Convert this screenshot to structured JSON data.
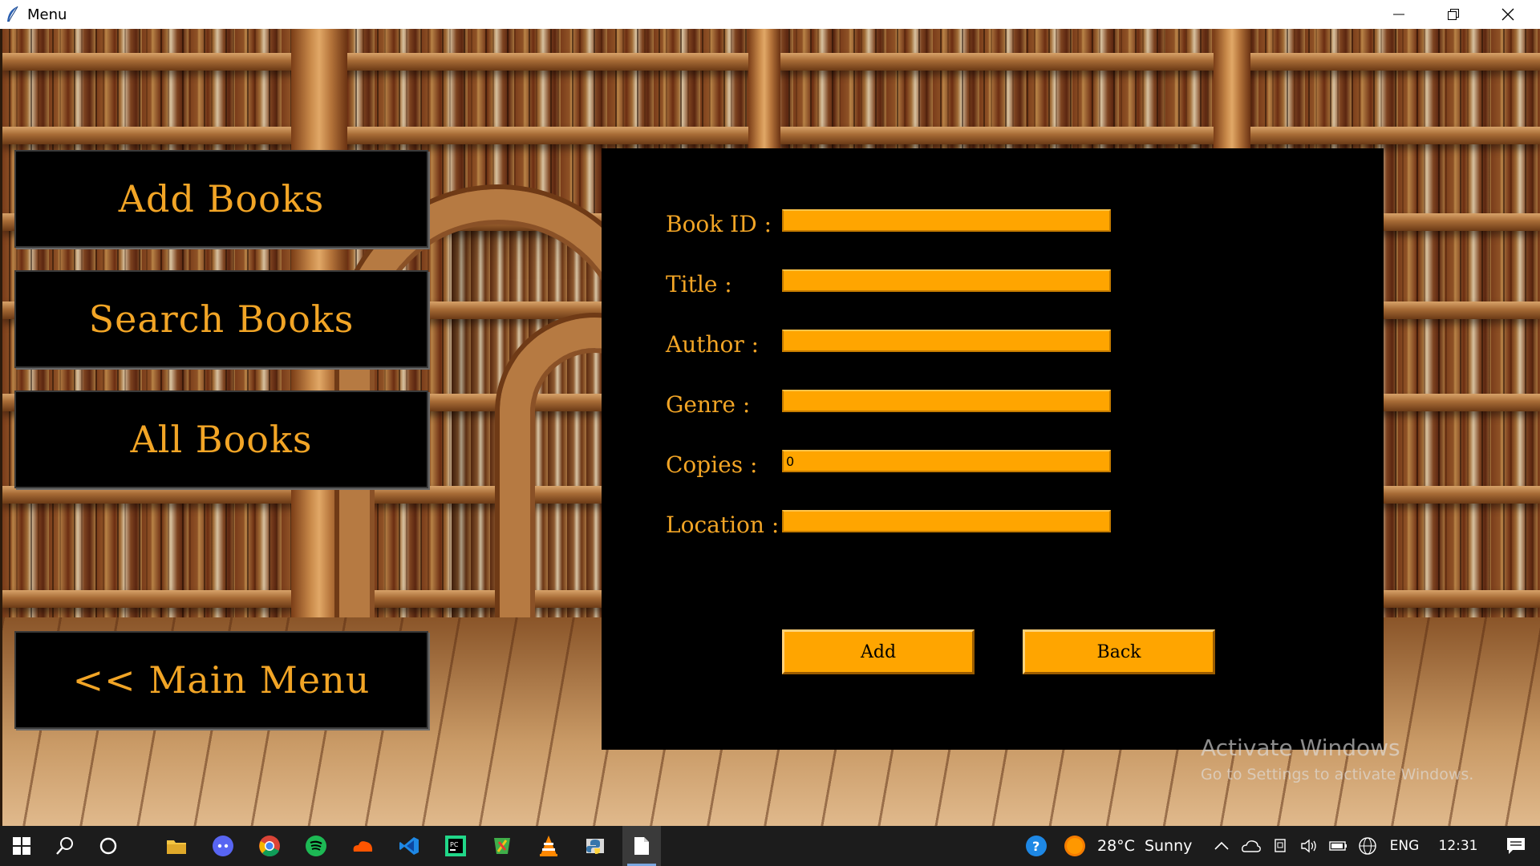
{
  "window": {
    "title": "Menu",
    "controls": [
      "minimize",
      "maximize",
      "close"
    ]
  },
  "menu": {
    "add_books": "Add Books",
    "search_books": "Search Books",
    "all_books": "All Books",
    "main_menu": "<< Main Menu"
  },
  "form": {
    "fields": [
      {
        "label": "Book ID :",
        "value": ""
      },
      {
        "label": "Title :",
        "value": ""
      },
      {
        "label": "Author :",
        "value": ""
      },
      {
        "label": "Genre :",
        "value": ""
      },
      {
        "label": "Copies :",
        "value": "0"
      },
      {
        "label": "Location :",
        "value": ""
      }
    ],
    "add_label": "Add",
    "back_label": "Back"
  },
  "colors": {
    "accent": "#ffa500",
    "label_text": "#f2a526",
    "panel_bg": "#000000"
  },
  "watermark": {
    "line1": "Activate Windows",
    "line2": "Go to Settings to activate Windows."
  },
  "taskbar": {
    "apps": [
      "windows-start",
      "search",
      "cortana",
      "file-explorer",
      "discord",
      "chrome",
      "spotify",
      "soundcloud",
      "vscode",
      "pycharm",
      "app-green",
      "vlc",
      "python-idle",
      "notepad"
    ],
    "weather_temp": "28°C",
    "weather_text": "Sunny",
    "language": "ENG",
    "time": "12:31"
  }
}
